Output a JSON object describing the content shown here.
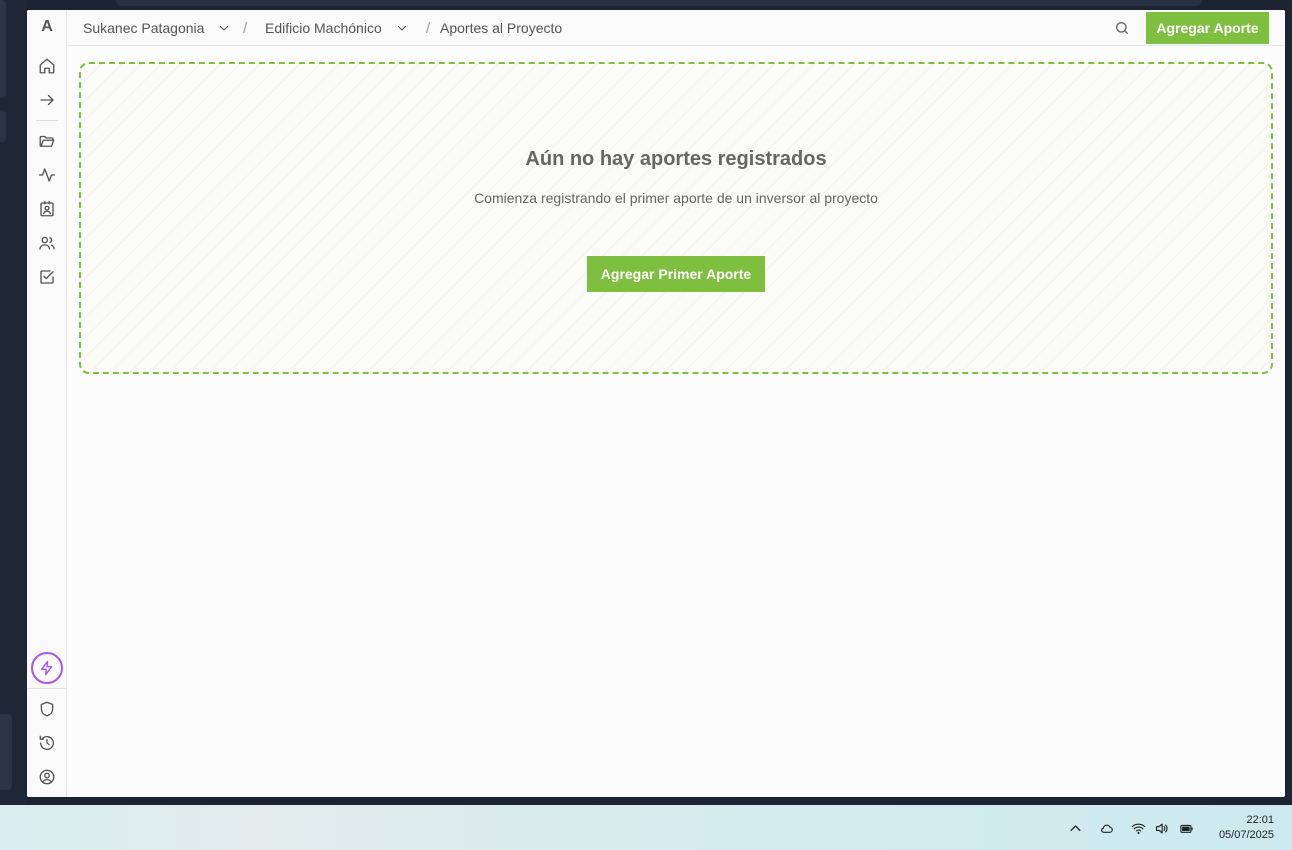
{
  "app": {
    "logo_letter": "A"
  },
  "breadcrumb": {
    "org": "Sukanec Patagonia",
    "project": "Edificio Machónico",
    "page": "Aportes al Proyecto",
    "separator": "/"
  },
  "toolbar": {
    "add_label": "Agregar Aporte"
  },
  "empty_state": {
    "title": "Aún no hay aportes registrados",
    "subtitle": "Comienza registrando el primer aporte de un inversor al proyecto",
    "button_label": "Agregar Primer Aporte"
  },
  "sidebar": {
    "items": [
      {
        "icon": "home-icon"
      },
      {
        "icon": "arrow-right-icon"
      },
      {
        "icon": "folder-open-icon"
      },
      {
        "icon": "activity-icon"
      },
      {
        "icon": "contact-card-icon"
      },
      {
        "icon": "users-icon"
      },
      {
        "icon": "check-square-icon"
      }
    ],
    "bottom_items": [
      {
        "icon": "bolt-icon"
      },
      {
        "icon": "shield-icon"
      },
      {
        "icon": "history-icon"
      },
      {
        "icon": "user-circle-icon"
      }
    ]
  },
  "taskbar": {
    "time": "22:01",
    "date": "05/07/2025",
    "tray_icons": [
      "chevron-up-icon",
      "cloud-icon",
      "wifi-icon",
      "volume-icon",
      "battery-icon"
    ]
  },
  "colors": {
    "accent": "#7fbf3f",
    "bolt": "#a855f7"
  }
}
